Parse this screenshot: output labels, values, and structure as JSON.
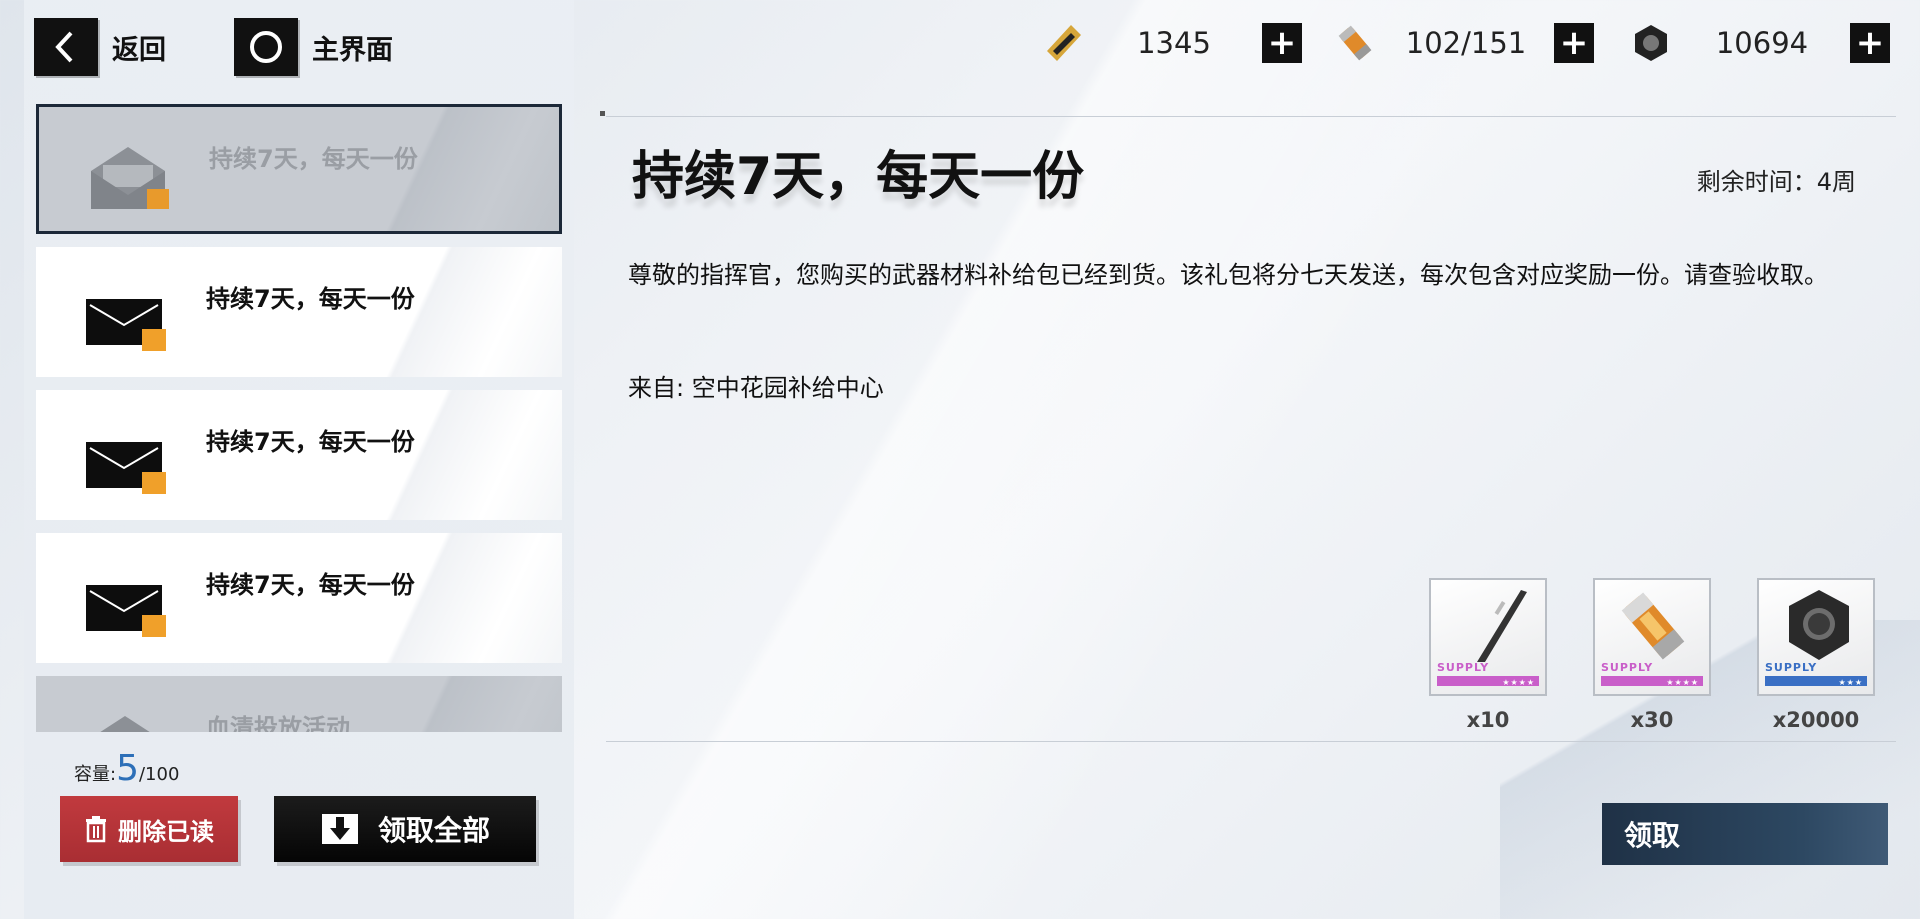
{
  "nav": {
    "back_label": "返回",
    "home_label": "主界面"
  },
  "resources": [
    {
      "icon": "ticket-icon",
      "value": "1345"
    },
    {
      "icon": "battery-icon",
      "value": "102/151"
    },
    {
      "icon": "hex-nut-icon",
      "value": "10694"
    }
  ],
  "mail_list": [
    {
      "title": "持续7天，每天一份",
      "state": "read-selected"
    },
    {
      "title": "持续7天，每天一份",
      "state": "unread"
    },
    {
      "title": "持续7天，每天一份",
      "state": "unread"
    },
    {
      "title": "持续7天，每天一份",
      "state": "unread"
    },
    {
      "title": "血清投放活动",
      "state": "read"
    }
  ],
  "capacity": {
    "label": "容量:",
    "current": "5",
    "max": "/100"
  },
  "actions": {
    "delete_read": "删除已读",
    "collect_all": "领取全部",
    "claim": "领取"
  },
  "detail": {
    "title": "持续7天，每天一份",
    "remaining": "剩余时间：4周",
    "body": "尊敬的指挥官，您购买的武器材料补给包已经到货。该礼包将分七天发送，每次包含对应奖励一份。请查验收取。",
    "sender": "来自: 空中花园补给中心"
  },
  "rewards": [
    {
      "icon": "weapon-blade-icon",
      "supply": "SUPPLY",
      "stars": "★★★★",
      "rarity_color": "#c95ec9",
      "qty": "x10"
    },
    {
      "icon": "battery-icon",
      "supply": "SUPPLY",
      "stars": "★★★★",
      "rarity_color": "#c95ec9",
      "qty": "x30"
    },
    {
      "icon": "hex-nut-icon",
      "supply": "SUPPLY",
      "stars": "★★★",
      "rarity_color": "#3a6fc4",
      "qty": "x20000"
    }
  ]
}
